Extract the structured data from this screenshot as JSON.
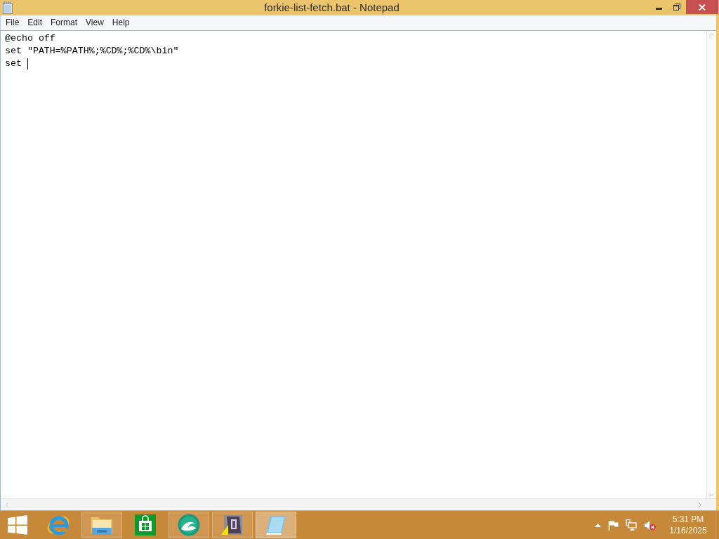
{
  "window": {
    "title": "forkie-list-fetch.bat - Notepad"
  },
  "menu": [
    "File",
    "Edit",
    "Format",
    "View",
    "Help"
  ],
  "editor": {
    "lines": [
      "@echo off",
      "set \"PATH=%PATH%;%CD%;%CD%\\bin\"",
      "set "
    ]
  },
  "taskbar": {
    "apps": [
      {
        "kind": "browser",
        "running": false,
        "selected": false
      },
      {
        "kind": "folder",
        "running": true,
        "selected": false
      },
      {
        "kind": "store",
        "running": false,
        "selected": false
      },
      {
        "kind": "wave",
        "running": true,
        "selected": false
      },
      {
        "kind": "figure",
        "running": true,
        "selected": false
      },
      {
        "kind": "notepad",
        "running": true,
        "selected": true
      }
    ]
  },
  "tray": {
    "muted": true,
    "time": "5:31 PM",
    "date": "1/16/2025"
  }
}
